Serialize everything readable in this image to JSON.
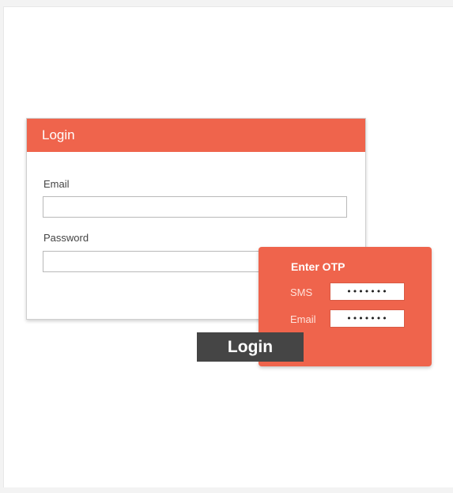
{
  "login_form": {
    "title": "Login",
    "email_label": "Email",
    "email_value": "",
    "password_label": "Password",
    "password_value": ""
  },
  "otp_panel": {
    "title": "Enter OTP",
    "sms_label": "SMS",
    "sms_value": "•••••••",
    "email_label": "Email",
    "email_value": "•••••••"
  },
  "login_button_label": "Login",
  "colors": {
    "accent": "#ef644c",
    "button": "#454545",
    "border": "#b9b9b9"
  }
}
